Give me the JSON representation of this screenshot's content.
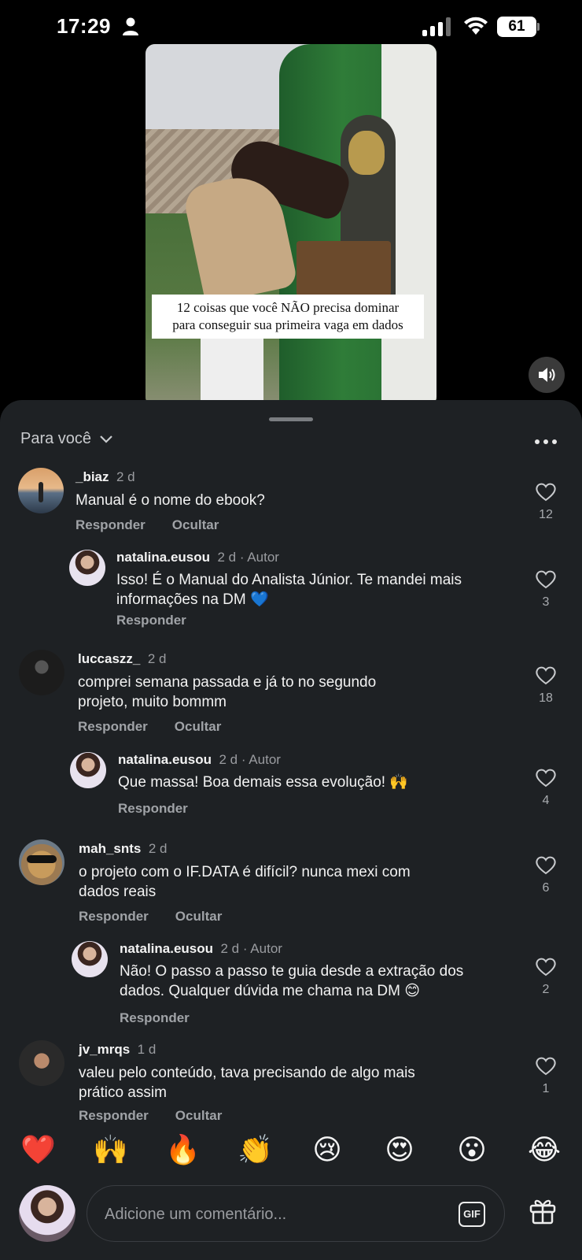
{
  "status_bar": {
    "time": "17:29",
    "battery": "61"
  },
  "video": {
    "caption_line1": "12 coisas que você NÃO precisa dominar",
    "caption_line2": "para conseguir sua primeira vaga em dados"
  },
  "sheet": {
    "filter_label": "Para você"
  },
  "comments": [
    {
      "user": "_biaz",
      "time": "2 d",
      "author": "",
      "text": "Manual é o nome do ebook?",
      "reply": "Responder",
      "hide": "Ocultar",
      "likes": "12"
    },
    {
      "user": "natalina.eusou",
      "time": "2 d",
      "author": "· Autor",
      "text": "Isso! É o Manual do Analista Júnior. Te mandei mais informações na DM 💙",
      "reply": "Responder",
      "hide": "",
      "likes": "3"
    },
    {
      "user": "luccaszz_",
      "time": "2 d",
      "author": "",
      "text": "comprei semana passada e já to no segundo projeto, muito bommm",
      "reply": "Responder",
      "hide": "Ocultar",
      "likes": "18"
    },
    {
      "user": "natalina.eusou",
      "time": "2 d",
      "author": "· Autor",
      "text": "Que massa! Boa demais essa evolução! 🙌",
      "reply": "Responder",
      "hide": "",
      "likes": "4"
    },
    {
      "user": "mah_snts",
      "time": "2 d",
      "author": "",
      "text": "o projeto com o IF.DATA é difícil? nunca mexi com dados reais",
      "reply": "Responder",
      "hide": "Ocultar",
      "likes": "6"
    },
    {
      "user": "natalina.eusou",
      "time": "2 d",
      "author": "· Autor",
      "text": "Não! O passo a passo te guia desde a extração dos dados. Qualquer dúvida me chama na DM 😊",
      "reply": "Responder",
      "hide": "",
      "likes": "2"
    },
    {
      "user": "jv_mrqs",
      "time": "1 d",
      "author": "",
      "text": "valeu pelo conteúdo, tava precisando de algo mais prático assim",
      "reply": "Responder",
      "hide": "Ocultar",
      "likes": "1"
    }
  ],
  "emojis": [
    "❤️",
    "🙌",
    "🔥",
    "👏",
    "😢",
    "😍",
    "😮",
    "😂"
  ],
  "input": {
    "placeholder": "Adicione um comentário...",
    "gif_label": "GIF"
  }
}
